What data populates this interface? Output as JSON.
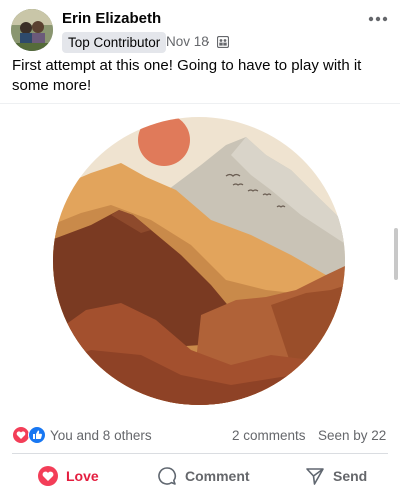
{
  "post": {
    "author": "Erin Elizabeth",
    "badge": "Top Contributor",
    "date": "Nov 18",
    "meta_separator": "·",
    "privacy_icon": "group-icon",
    "text": "First attempt at this one! Going to have to play with it some more!",
    "image": {
      "description_icon": "mountain-sun-painting"
    }
  },
  "stats": {
    "reaction_icons": [
      "love-icon",
      "like-icon"
    ],
    "summary": "You and 8 others",
    "comments": "2 comments",
    "seen": "Seen by 22"
  },
  "actions": {
    "love": "Love",
    "comment": "Comment",
    "send": "Send"
  },
  "colors": {
    "love_red": "#e41e3f",
    "like_blue": "#1877f2",
    "secondary_text": "#65676b",
    "badge_bg": "#e4e6eb"
  }
}
